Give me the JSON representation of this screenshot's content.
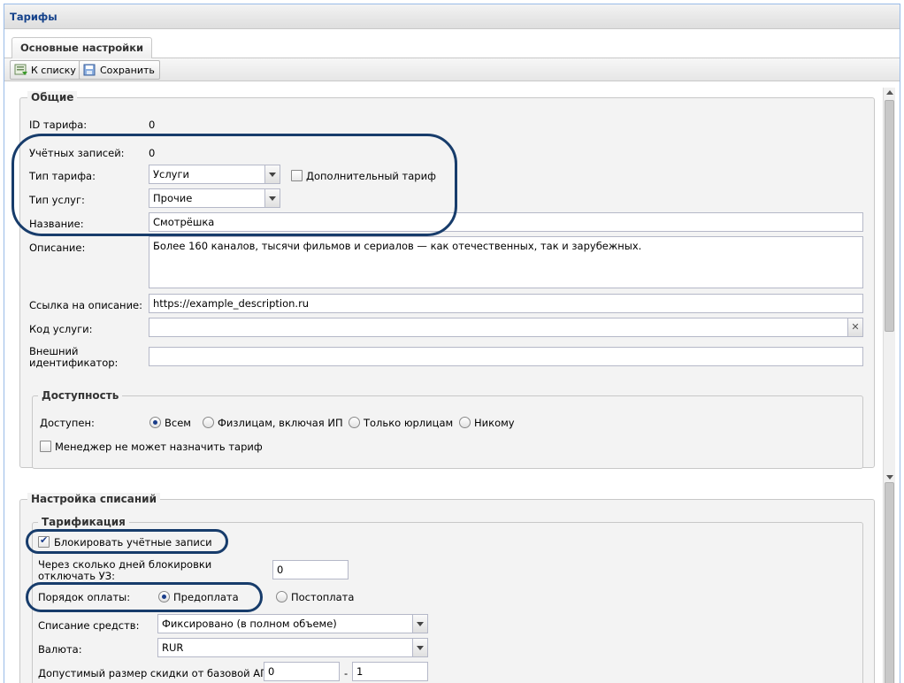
{
  "window": {
    "title": "Тарифы"
  },
  "tabs": [
    {
      "label": "Основные настройки"
    }
  ],
  "toolbar": {
    "back_label": "К списку",
    "save_label": "Сохранить"
  },
  "general": {
    "legend": "Общие",
    "id_label": "ID тарифа:",
    "id_value": "0",
    "accounts_label": "Учётных записей:",
    "accounts_value": "0",
    "tariff_type_label": "Тип тарифа:",
    "tariff_type_value": "Услуги",
    "additional_tariff_label": "Дополнительный тариф",
    "service_type_label": "Тип услуг:",
    "service_type_value": "Прочие",
    "name_label": "Название:",
    "name_value": "Смотрёшка",
    "description_label": "Описание:",
    "description_value": "Более 160 каналов, тысячи фильмов и сериалов — как отечественных, так и зарубежных.",
    "link_label": "Ссылка на описание:",
    "link_value": "https://example_description.ru",
    "service_code_label": "Код услуги:",
    "service_code_value": "",
    "external_id_label": "Внешний идентификатор:",
    "external_id_value": ""
  },
  "availability": {
    "legend": "Доступность",
    "available_label": "Доступен:",
    "options": [
      "Всем",
      "Физлицам, включая ИП",
      "Только юрлицам",
      "Никому"
    ],
    "selected": "Всем",
    "manager_cannot_assign_label": "Менеджер не может назначить тариф"
  },
  "charges": {
    "legend": "Настройка списаний",
    "tarification_legend": "Тарификация",
    "block_accounts_label": "Блокировать учётные записи",
    "block_accounts_checked": true,
    "days_label": "Через сколько дней блокировки отключать УЗ:",
    "days_value": "0",
    "payment_order_label": "Порядок оплаты:",
    "payment_options": [
      "Предоплата",
      "Постоплата"
    ],
    "payment_selected": "Предоплата",
    "write_off_label": "Списание средств:",
    "write_off_value": "Фиксировано (в полном объеме)",
    "currency_label": "Валюта:",
    "currency_value": "RUR",
    "discount_label": "Допустимый размер скидки от базовой АП:",
    "discount_from": "0",
    "discount_sep": "-",
    "discount_to": "1"
  }
}
